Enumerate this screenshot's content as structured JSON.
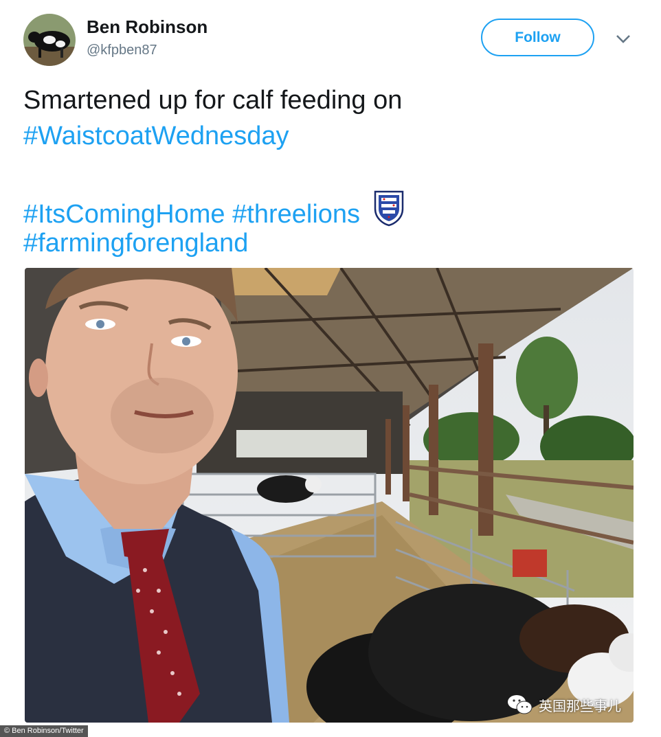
{
  "user": {
    "display_name": "Ben Robinson",
    "handle": "@kfpben87"
  },
  "follow_label": "Follow",
  "tweet": {
    "line1": "Smartened up for calf feeding on",
    "hashtag_waistcoat": "#WaistcoatWednesday",
    "hashtag_coming_home": "#ItsComingHome",
    "hashtag_threelions": "#threelions",
    "hashtag_farming": "#farmingforengland"
  },
  "icons": {
    "more": "chevron-down-icon",
    "crest": "england-crest-icon",
    "watermark": "wechat-icon"
  },
  "colors": {
    "link": "#1da1f2",
    "text": "#14171a",
    "secondary": "#657786"
  },
  "photo_credit": "© Ben Robinson/Twitter",
  "watermark_text": "英国那些事儿"
}
